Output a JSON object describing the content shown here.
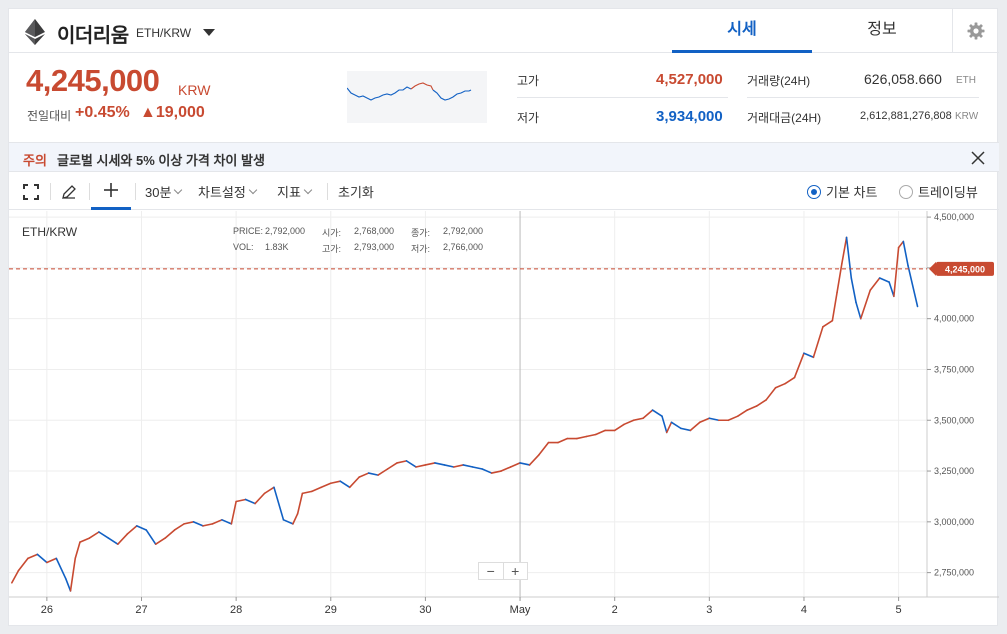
{
  "header": {
    "coin_name": "이더리움",
    "pair": "ETH/KRW",
    "tabs": [
      "시세",
      "정보"
    ],
    "icons": {
      "logo": "ethereum-icon",
      "dropdown": "chevron-down-icon",
      "settings": "gear-icon"
    }
  },
  "summary": {
    "price": "4,245,000",
    "unit": "KRW",
    "change_label": "전일대비",
    "change_pct": "+0.45%",
    "change_amt": "▲19,000",
    "high_label": "고가",
    "high": "4,527,000",
    "low_label": "저가",
    "low": "3,934,000",
    "volume_label": "거래량(24H)",
    "volume": "626,058.660",
    "volume_unit": "ETH",
    "value_label": "거래대금(24H)",
    "value": "2,612,881,276,808",
    "value_unit": "KRW"
  },
  "notice": {
    "tag": "주의",
    "text": "글로벌 시세와 5% 이상 가격 차이 발생"
  },
  "toolbar": {
    "interval": "30분",
    "chart_settings": "차트설정",
    "indicators": "지표",
    "reset": "초기화",
    "basic_chart": "기본 차트",
    "tradingview": "트레이딩뷰",
    "basic_selected": true
  },
  "info": {
    "symbol": "ETH/KRW",
    "price_label": "PRICE:",
    "price": "2,792,000",
    "open_label": "시가:",
    "open": "2,768,000",
    "close_label": "종가:",
    "close": "2,792,000",
    "vol_label": "VOL:",
    "vol": "1.83K",
    "high_label": "고가:",
    "high": "2,793,000",
    "low_label": "저가:",
    "low": "2,766,000"
  },
  "colors": {
    "up": "#c84a31",
    "down": "#1261c4",
    "accent": "#1261c4"
  },
  "chart_data": {
    "type": "line",
    "title": "ETH/KRW",
    "x_ticks": [
      "26",
      "27",
      "28",
      "29",
      "30",
      "May",
      "2",
      "3",
      "4",
      "5"
    ],
    "y_ticks": [
      "2,750,000",
      "3,000,000",
      "3,250,000",
      "3,500,000",
      "3,750,000",
      "4,000,000",
      "4,250,000",
      "4,500,000"
    ],
    "y_values": [
      2750000,
      3000000,
      3250000,
      3500000,
      3750000,
      4000000,
      4250000,
      4500000
    ],
    "ylim": [
      2630000,
      4530000
    ],
    "current_price_label": "4,245,000",
    "current_price": 4245000,
    "series": [
      {
        "x": [
          25.63,
          25.7,
          25.8,
          25.9,
          26.0,
          26.1,
          26.2,
          26.25,
          26.3,
          26.35,
          26.45,
          26.55,
          26.65,
          26.75,
          26.85,
          26.95,
          27.05,
          27.15,
          27.25,
          27.35,
          27.45,
          27.55,
          27.65,
          27.75,
          27.85,
          27.95,
          28.0,
          28.1,
          28.2,
          28.3,
          28.4,
          28.5,
          28.6,
          28.65,
          28.7,
          28.8,
          28.9,
          29.0,
          29.1,
          29.2,
          29.3,
          29.4,
          29.5,
          29.6,
          29.7,
          29.8,
          29.9,
          30.0,
          30.1,
          30.2,
          30.3,
          30.4,
          30.5,
          30.6,
          30.7,
          30.8,
          30.9,
          31.0,
          31.1,
          31.2,
          31.3,
          31.4,
          31.5,
          31.6,
          31.7,
          31.8,
          31.9,
          32.0,
          32.1,
          32.2,
          32.3,
          32.4,
          32.5,
          32.55,
          32.6,
          32.7,
          32.8,
          32.9,
          33.0,
          33.1,
          33.2,
          33.3,
          33.4,
          33.5,
          33.6,
          33.7,
          33.8,
          33.9,
          34.0,
          34.1,
          34.2,
          34.3,
          34.35,
          34.4,
          34.45,
          34.5,
          34.55,
          34.6,
          34.7,
          34.8,
          34.9,
          34.95,
          35.0,
          35.05,
          35.1,
          35.2
        ],
        "y": [
          2700000,
          2760000,
          2820000,
          2840000,
          2800000,
          2820000,
          2720000,
          2660000,
          2820000,
          2900000,
          2920000,
          2950000,
          2920000,
          2890000,
          2940000,
          2980000,
          2960000,
          2890000,
          2920000,
          2960000,
          2990000,
          3000000,
          2980000,
          2990000,
          3010000,
          2990000,
          3100000,
          3110000,
          3090000,
          3140000,
          3170000,
          3010000,
          2990000,
          3040000,
          3140000,
          3150000,
          3170000,
          3190000,
          3200000,
          3170000,
          3220000,
          3240000,
          3230000,
          3260000,
          3290000,
          3300000,
          3270000,
          3280000,
          3290000,
          3280000,
          3270000,
          3280000,
          3270000,
          3260000,
          3240000,
          3250000,
          3270000,
          3290000,
          3280000,
          3330000,
          3390000,
          3390000,
          3410000,
          3410000,
          3420000,
          3430000,
          3450000,
          3450000,
          3480000,
          3500000,
          3510000,
          3550000,
          3520000,
          3440000,
          3490000,
          3460000,
          3450000,
          3490000,
          3510000,
          3500000,
          3500000,
          3520000,
          3550000,
          3570000,
          3600000,
          3660000,
          3680000,
          3710000,
          3830000,
          3810000,
          3960000,
          3990000,
          4130000,
          4270000,
          4400000,
          4200000,
          4080000,
          4000000,
          4140000,
          4200000,
          4180000,
          4110000,
          4350000,
          4380000,
          4260000,
          4060000
        ]
      }
    ],
    "x_range": [
      25.6,
      35.3
    ],
    "grid": true
  }
}
